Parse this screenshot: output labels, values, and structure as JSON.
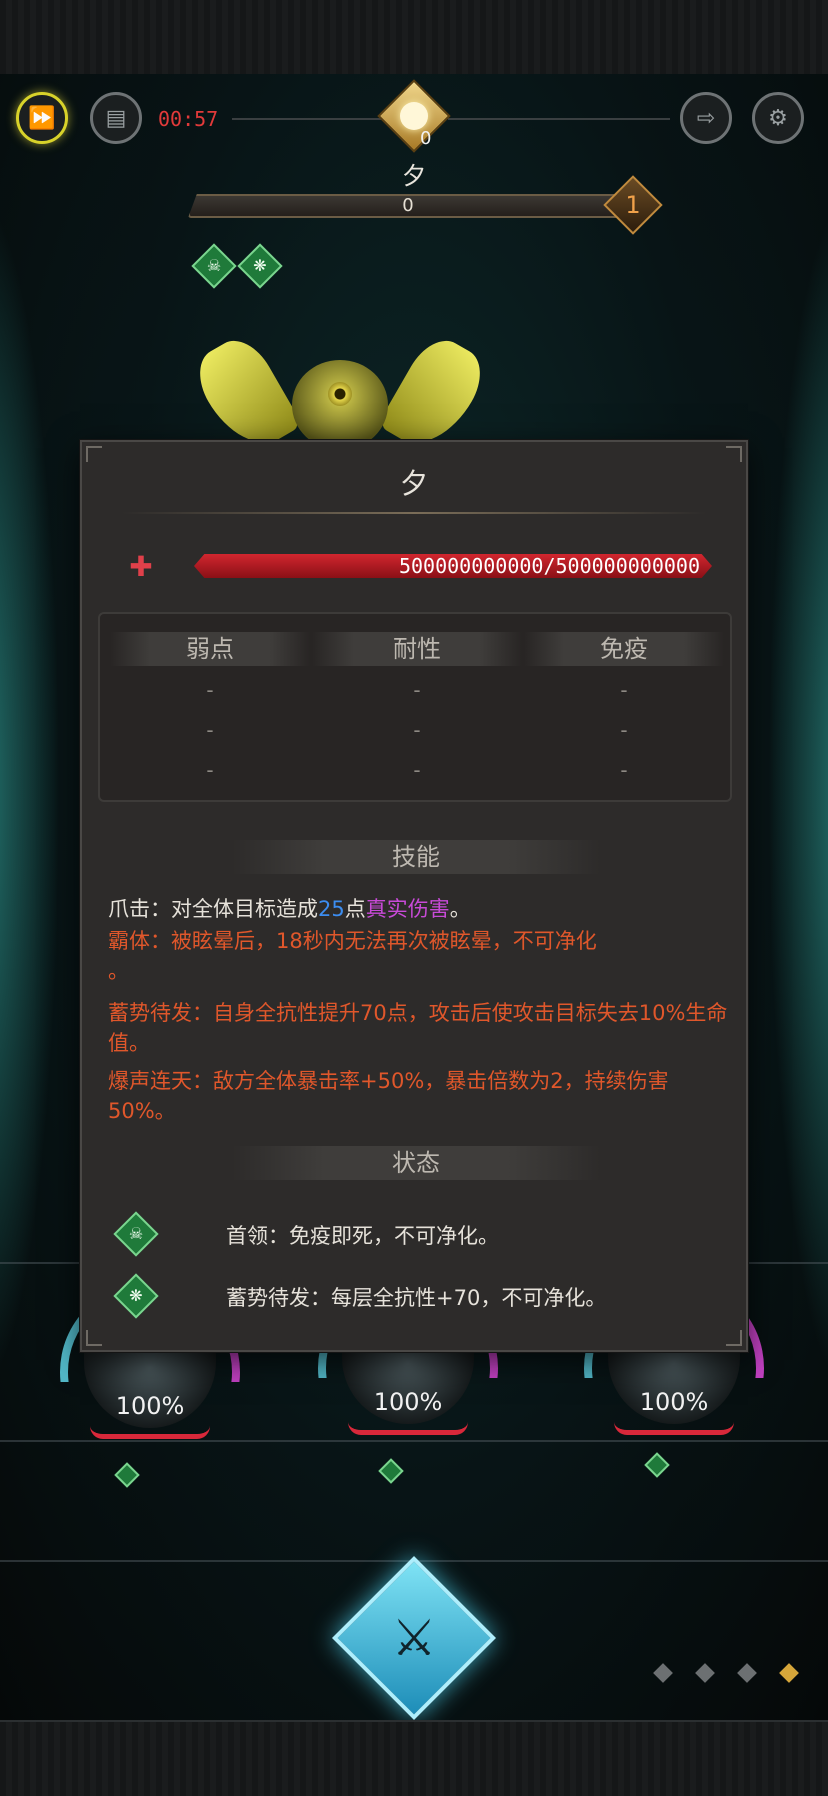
{
  "hud": {
    "timer": "00:57",
    "emblem_count": "0",
    "boss_name": "夕",
    "boss_bar_value": "0",
    "stack_count": "1"
  },
  "panel": {
    "title": "夕",
    "hp_text": "500000000000/500000000000",
    "resist_headers": [
      "弱点",
      "耐性",
      "免疫"
    ],
    "resist_rows": [
      [
        "-",
        "-",
        "-"
      ],
      [
        "-",
        "-",
        "-"
      ],
      [
        "-",
        "-",
        "-"
      ]
    ],
    "skills_header": "技能",
    "skills": {
      "s1_prefix": "爪击：对全体目标造成",
      "s1_number": "25",
      "s1_mid": "点",
      "s1_type": "真实伤害",
      "s1_end": "。",
      "s2": "霸体：被眩晕后，18秒内无法再次被眩晕，不可净化",
      "s2_tail": "。",
      "s3": "蓄势待发：自身全抗性提升70点，攻击后使攻击目标失去10%生命值。",
      "s4": "爆声连天：敌方全体暴击率+50%，暴击倍数为2，持续伤害50%。"
    },
    "status_header": "状态",
    "statuses": [
      {
        "icon": "skull-icon",
        "text": "首领：免疫即死，不可净化。"
      },
      {
        "icon": "swirl-icon",
        "text": "蓄势待发：每层全抗性+70，不可净化。"
      }
    ]
  },
  "party": [
    {
      "hp": "100%"
    },
    {
      "hp": "100%"
    },
    {
      "hp": "100%"
    }
  ],
  "colors": {
    "accent_gold": "#d6a63a",
    "hp_red": "#d1262f",
    "skill_orange": "#e0572b",
    "true_damage": "#c84ad8",
    "number_blue": "#3c8df0"
  }
}
